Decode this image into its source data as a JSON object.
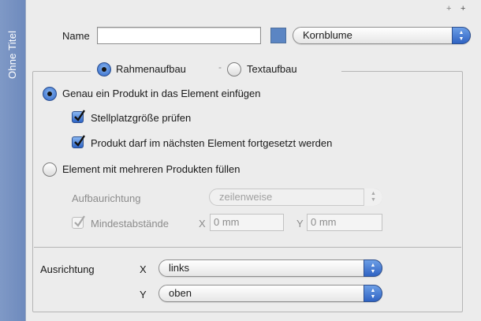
{
  "side_tab": {
    "title": "Ohne Titel"
  },
  "corner": {
    "plus1": "+",
    "plus2": "+"
  },
  "name_row": {
    "label": "Name",
    "value": "",
    "swatch_color": "#5b85c3",
    "color_select": "Kornblume"
  },
  "mode_tabs": {
    "frame": "Rahmenaufbau",
    "text": "Textaufbau",
    "selected": "frame"
  },
  "options": {
    "exact_one": "Genau ein Produkt in das Element einfügen",
    "check_size": "Stellplatzgröße prüfen",
    "continue_next": "Produkt darf im nächsten Element fortgesetzt werden",
    "fill_multiple": "Element mit mehreren Produkten füllen"
  },
  "build": {
    "direction_label": "Aufbaurichtung",
    "direction_value": "zeilenweise",
    "min_spacing_label": "Mindestabstände",
    "x_label": "X",
    "x_value": "0 mm",
    "y_label": "Y",
    "y_value": "0 mm"
  },
  "alignment": {
    "label": "Ausrichtung",
    "x_label": "X",
    "x_value": "links",
    "y_label": "Y",
    "y_value": "oben"
  },
  "colors": {
    "accent": "#2d64c6",
    "side_tab": "#7892c3"
  }
}
